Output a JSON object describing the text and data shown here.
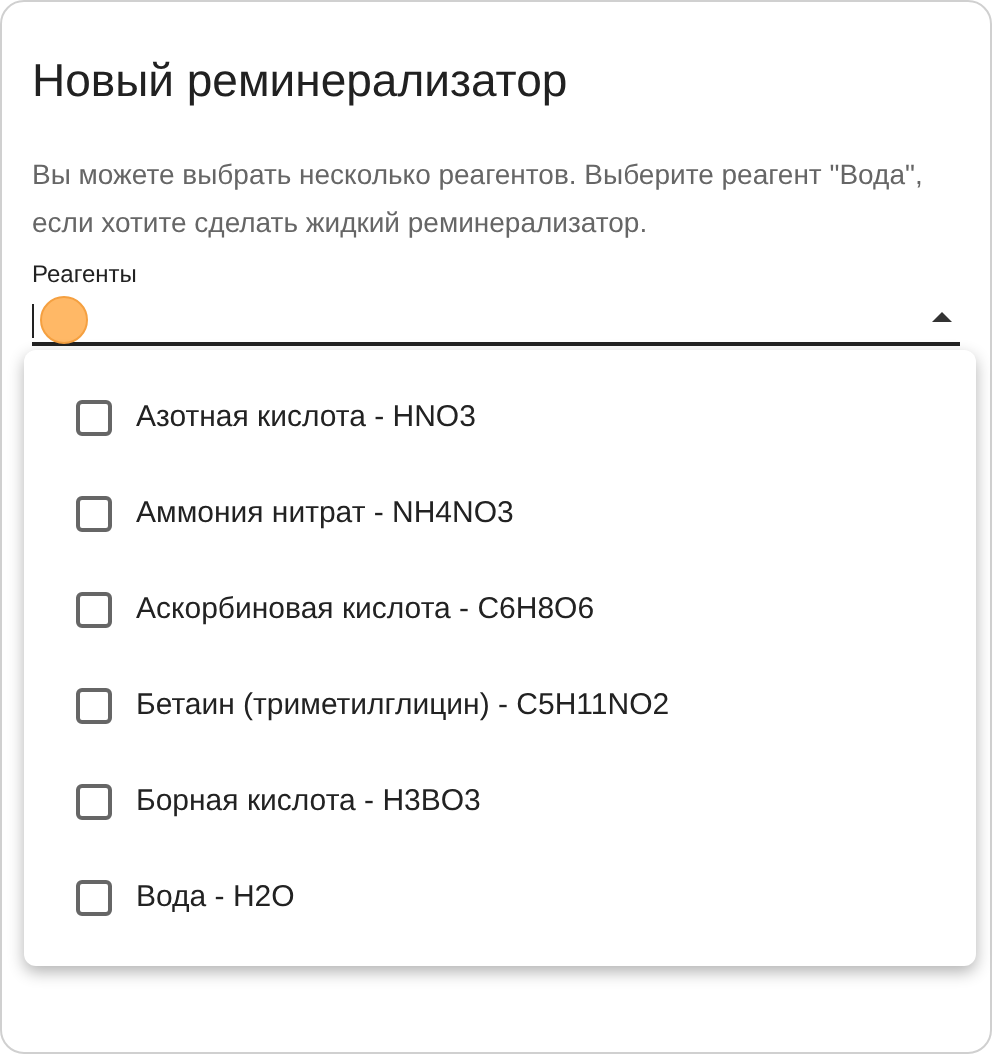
{
  "dialog": {
    "title": "Новый реминерализатор",
    "description": "Вы можете выбрать несколько реагентов. Выберите реагент \"Вода\", если хотите сделать жидкий реминерализатор.",
    "field": {
      "label": "Реагенты",
      "expanded": true
    },
    "options": [
      {
        "label": "Азотная кислота - HNO3",
        "checked": false
      },
      {
        "label": "Аммония нитрат - NH4NO3",
        "checked": false
      },
      {
        "label": "Аскорбиновая кислота - C6H8O6",
        "checked": false
      },
      {
        "label": "Бетаин (триметилглицин) - C5H11NO2",
        "checked": false
      },
      {
        "label": "Борная кислота - H3BO3",
        "checked": false
      },
      {
        "label": "Вода - H2O",
        "checked": false
      }
    ]
  }
}
